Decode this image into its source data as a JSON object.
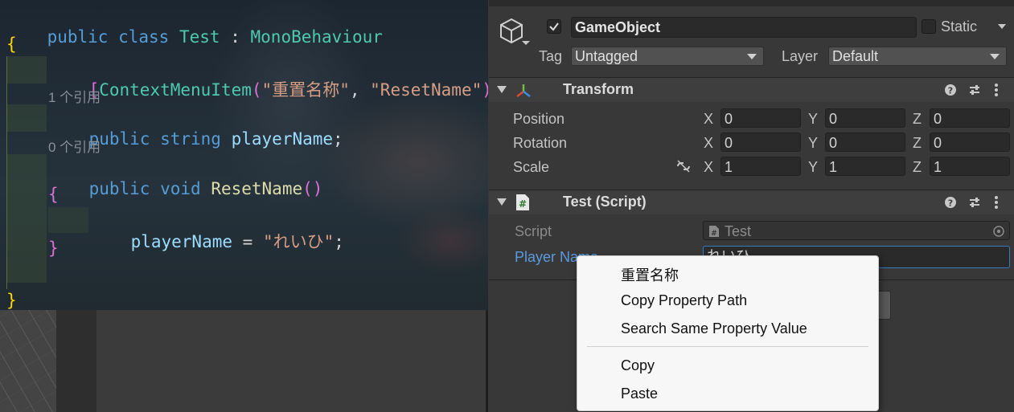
{
  "code": {
    "line1": {
      "kw1": "public",
      "kw2": "class",
      "type": "Test",
      "colon": ":",
      "base": "MonoBehaviour"
    },
    "open_brace": "{",
    "attr": {
      "open": "[",
      "name": "ContextMenuItem",
      "paren_open": "(",
      "arg1": "\"重置名称\"",
      "comma": ",",
      "arg2": "\"ResetName\"",
      "paren_close": ")",
      "close": "]"
    },
    "hint1": "1 个引用",
    "field": {
      "kw1": "public",
      "kw2": "string",
      "name": "playerName",
      "semi": ";"
    },
    "hint2": "0 个引用",
    "method": {
      "kw1": "public",
      "kw2": "void",
      "name": "ResetName",
      "parens": "()"
    },
    "method_open": "{",
    "assign": {
      "lhs": "playerName",
      "op": "=",
      "value": "\"れいひ\"",
      "semi": ";"
    },
    "method_close": "}",
    "class_close": "}"
  },
  "inspector": {
    "object_name": "GameObject",
    "static_label": "Static",
    "tag_label": "Tag",
    "tag_value": "Untagged",
    "layer_label": "Layer",
    "layer_value": "Default",
    "transform": {
      "title": "Transform",
      "rows": [
        {
          "label": "Position",
          "x": "0",
          "y": "0",
          "z": "0"
        },
        {
          "label": "Rotation",
          "x": "0",
          "y": "0",
          "z": "0"
        },
        {
          "label": "Scale",
          "x": "1",
          "y": "1",
          "z": "1"
        }
      ],
      "axis_x": "X",
      "axis_y": "Y",
      "axis_z": "Z"
    },
    "script_component": {
      "title": "Test (Script)",
      "script_label": "Script",
      "script_value": "Test",
      "player_name_label": "Player Name",
      "player_name_value": "れいひ"
    }
  },
  "context_menu": {
    "items": [
      "重置名称",
      "Copy Property Path",
      "Search Same Property Value",
      "Copy",
      "Paste"
    ]
  },
  "colors": {
    "accent_blue": "#3a79bb",
    "menu_bg": "#f7f7f7",
    "inspector_bg": "#383838"
  }
}
